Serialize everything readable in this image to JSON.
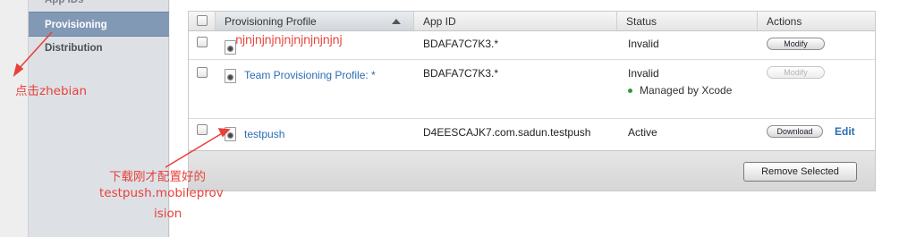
{
  "sidebar": {
    "items": [
      {
        "label": "App IDs"
      },
      {
        "label": "Provisioning"
      },
      {
        "label": "Distribution"
      }
    ]
  },
  "table": {
    "columns": [
      "Provisioning Profile",
      "App ID",
      "Status",
      "Actions"
    ],
    "rows": [
      {
        "profile": "",
        "app_id": "BDAFA7C7K3.*",
        "status": "Invalid",
        "managed": "",
        "action": "Modify",
        "action_enabled": true,
        "edit": ""
      },
      {
        "profile": "Team Provisioning Profile: *",
        "app_id": "BDAFA7C7K3.*",
        "status": "Invalid",
        "managed": "Managed by Xcode",
        "action": "Modify",
        "action_enabled": false,
        "edit": ""
      },
      {
        "profile": "testpush",
        "app_id": "D4EESCAJK7.com.sadun.testpush",
        "status": "Active",
        "managed": "",
        "action": "Download",
        "action_enabled": true,
        "edit": "Edit"
      }
    ],
    "remove_button": "Remove Selected"
  },
  "annotations": {
    "scribble": "njnjnjnjnjnjnjnjnjnjnj",
    "click_note": "点击zhebian",
    "download_note_line1": "下载刚才配置好的",
    "download_note_line2": "testpush.mobileprov",
    "download_note_line3": "ision",
    "color": "#e8413a"
  },
  "icons": [
    "sort-ascending-icon",
    "provisioning-file-icon",
    "status-dot-icon"
  ]
}
